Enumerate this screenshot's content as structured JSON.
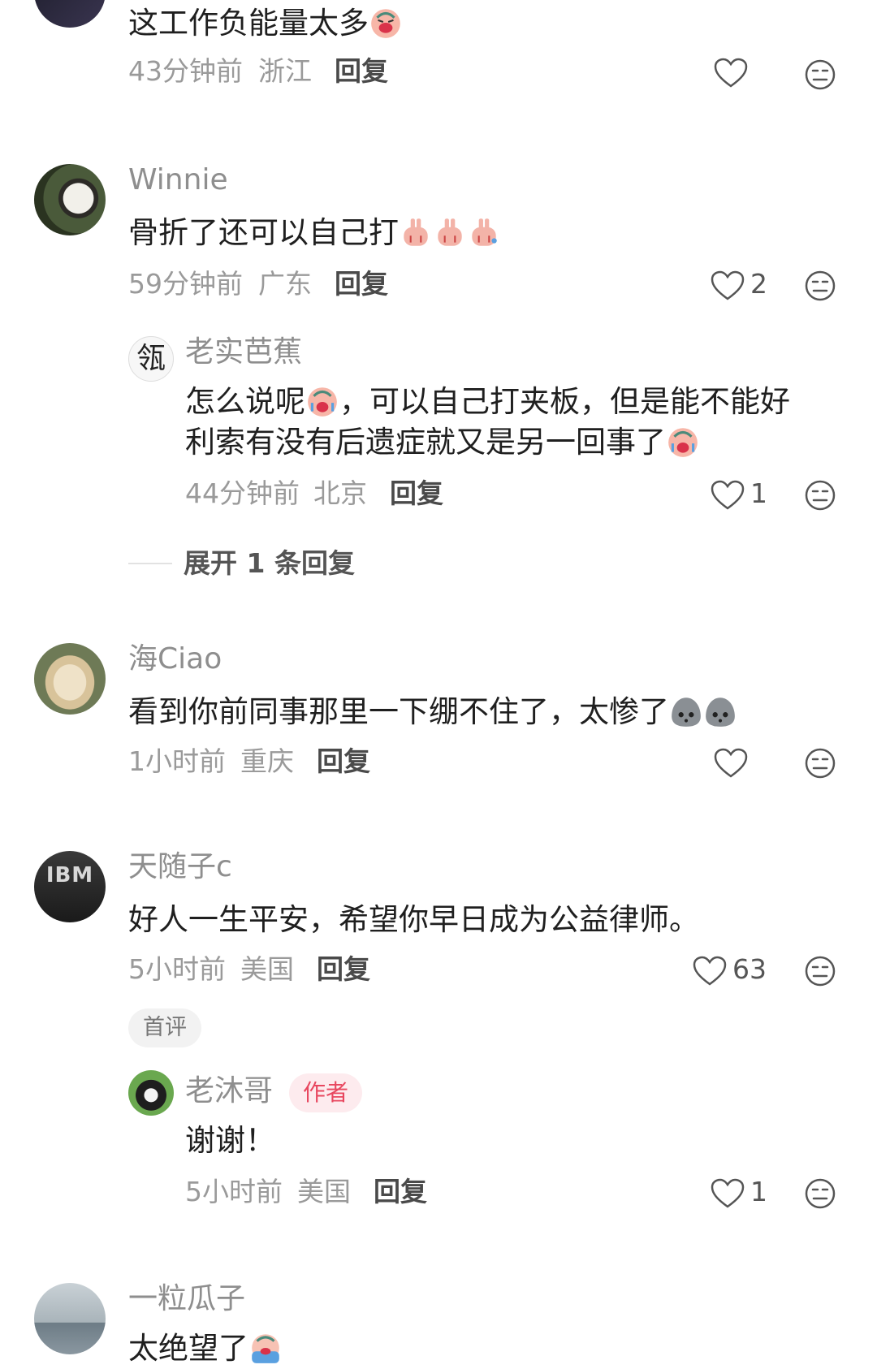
{
  "comments": [
    {
      "username": "",
      "text": "这工作负能量太多",
      "time": "43分钟前",
      "location": "浙江",
      "reply_label": "回复",
      "likes": ""
    },
    {
      "username": "Winnie",
      "text": "骨折了还可以自己打",
      "time": "59分钟前",
      "location": "广东",
      "reply_label": "回复",
      "likes": "2",
      "reply": {
        "username": "老实芭蕉",
        "avatar_glyph": "瓴",
        "text_line1a": "怎么说呢",
        "text_line1b": "，可以自己打夹板，但是能不能好",
        "text_line2": "利索有没有后遗症就又是另一回事了",
        "time": "44分钟前",
        "location": "北京",
        "reply_label": "回复",
        "likes": "1"
      },
      "expand_label": "展开 1 条回复"
    },
    {
      "username": "海Ciao",
      "text": "看到你前同事那里一下绷不住了，太惨了",
      "time": "1小时前",
      "location": "重庆",
      "reply_label": "回复",
      "likes": ""
    },
    {
      "username": "天随子c",
      "avatar_text": "IBM",
      "text": "好人一生平安，希望你早日成为公益律师。",
      "time": "5小时前",
      "location": "美国",
      "reply_label": "回复",
      "likes": "63",
      "badge": "首评",
      "reply": {
        "username": "老沐哥",
        "author_badge": "作者",
        "text": "谢谢！",
        "time": "5小时前",
        "location": "美国",
        "reply_label": "回复",
        "likes": "1"
      }
    },
    {
      "username": "一粒瓜子",
      "text": "太绝望了",
      "time": "",
      "location": "",
      "reply_label": "",
      "likes": ""
    }
  ],
  "colors": {
    "background": "#ffffff",
    "username": "#8e8e8e",
    "text": "#1f1f1f",
    "meta": "#9a9a9a",
    "author_badge": "#e8475f"
  },
  "icons": [
    "heart-icon",
    "dislike-face-icon",
    "crying-emoji-icon",
    "stone-face-emoji-icon",
    "fingers-emoji-icon"
  ]
}
